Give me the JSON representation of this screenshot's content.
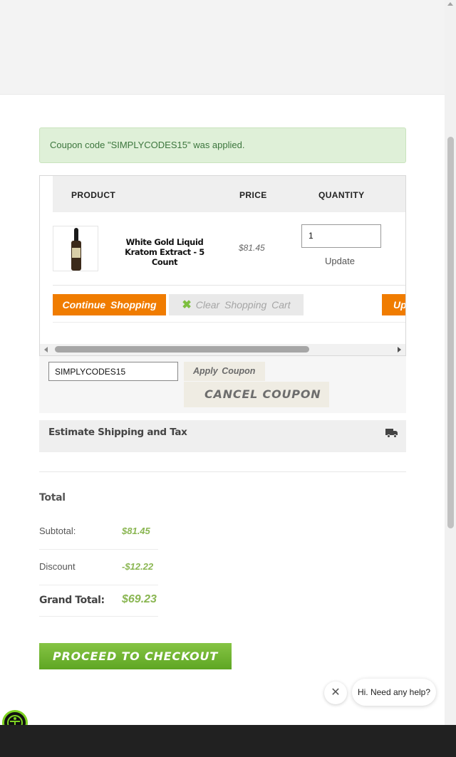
{
  "notice": {
    "text": "Coupon code \"SIMPLYCODES15\" was applied."
  },
  "cart": {
    "columns": [
      "PRODUCT",
      "PRICE",
      "QUANTITY"
    ],
    "items": [
      {
        "name": "White Gold Liquid Kratom Extract - 5 Count",
        "price": "$81.45",
        "quantity": "1",
        "update_label": "Update",
        "image_icon": "tincture-bottle-icon"
      }
    ],
    "buttons": {
      "continue": "Continue  Shopping",
      "clear": "Clear  Shopping  Cart",
      "update_cut": "Up"
    }
  },
  "coupon": {
    "value": "SIMPLYCODES15",
    "apply_label": "Apply  Coupon",
    "cancel_label": "CANCEL COUPON"
  },
  "shipping": {
    "title": "Estimate Shipping and Tax",
    "icon": "truck-icon"
  },
  "totals": {
    "title": "Total",
    "subtotal_label": "Subtotal:",
    "subtotal_value": "$81.45",
    "discount_label": "Discount",
    "discount_value": "-$12.22",
    "grand_label": "Grand Total:",
    "grand_value": "$69.23"
  },
  "checkout": {
    "label": "PROCEED TO CHECKOUT"
  },
  "chat": {
    "close_glyph": "✕",
    "bubble_text": "Hi. Need any help?"
  },
  "colors": {
    "accent_orange": "#f07c00",
    "accent_green": "#7dbf3f",
    "notice_bg": "#dff0d8",
    "footer": "#212121"
  }
}
